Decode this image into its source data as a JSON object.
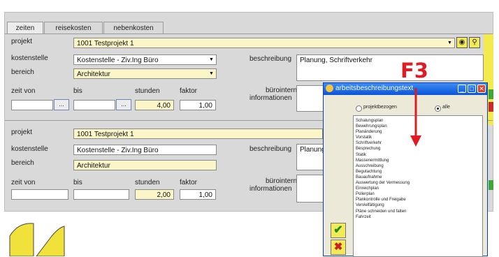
{
  "tabs": [
    "zeiten",
    "reisekosten",
    "nebenkosten"
  ],
  "top": {
    "projekt_label": "projekt",
    "projekt_value": "1001  Testprojekt 1",
    "kostenstelle_label": "kostenstelle",
    "kostenstelle_value": "Kostenstelle - Ziv.Ing Büro",
    "bereich_label": "bereich",
    "bereich_value": "Architektur",
    "zeit_von_label": "zeit von",
    "bis_label": "bis",
    "stunden_label": "stunden",
    "faktor_label": "faktor",
    "stunden_value": "4,00",
    "faktor_value": "1,00",
    "beschreibung_label": "beschreibung",
    "beschreibung_value": "Planung, Schriftverkehr",
    "buero_label_1": "büro­interne",
    "buero_label_2": "informationen",
    "picker_glyph": "...",
    "target_glyph": "◉",
    "search_glyph": "⚲"
  },
  "bottom": {
    "projekt_label": "projekt",
    "projekt_value": "1001  Testprojekt 1",
    "kostenstelle_label": "kostenstelle",
    "kostenstelle_value": "Kostenstelle - Ziv.Ing Büro",
    "bereich_label": "bereich",
    "bereich_value": "Architektur",
    "zeit_von_label": "zeit von",
    "bis_label": "bis",
    "stunden_label": "stunden",
    "faktor_label": "faktor",
    "stunden_value": "2,00",
    "faktor_value": "1,00",
    "beschreibung_label": "beschreibung",
    "beschreibung_value": "Planung",
    "buero_label_1": "büro­interne",
    "buero_label_2": "informationen"
  },
  "annotation": {
    "key": "F3"
  },
  "dialog": {
    "title": "arbeitsbeschreibungstext",
    "radio_projekt": "projektbezogen",
    "radio_alle": "alle",
    "items": [
      "Schalungsplan",
      "Bewehrungsplan",
      "Planänderung",
      "Vorstatik",
      "Schriftverkehr",
      "Besprechung",
      "Statik",
      "Massenermittlung",
      "Ausschreibung",
      "Begutachtung",
      "Bauaufnahme",
      "Auswertung der Vermessung",
      "Einreichplan",
      "Polierplan",
      "Plankontrolle und Freigabe",
      "Vervielfältigung",
      "Pläne schneiden und falten",
      "Fahrzeit"
    ],
    "ok_glyph": "✔",
    "cancel_glyph": "✖",
    "min_glyph": "_",
    "max_glyph": "□",
    "close_glyph": "✕"
  },
  "colors": {
    "yellow_field": "#fbf6c7",
    "yellow_strip": "#f4ea4d",
    "annotation_red": "#e11b22",
    "titlebar_blue": "#0a55d8"
  }
}
